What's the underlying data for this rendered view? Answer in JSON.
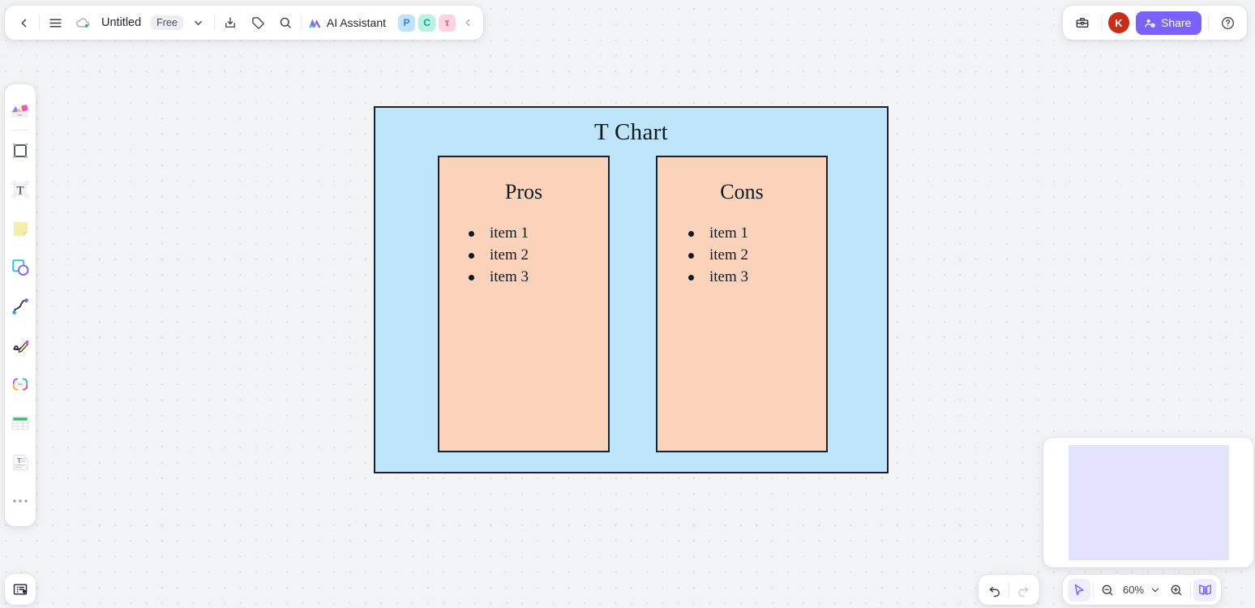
{
  "app": {
    "canvas_background": "#f2f3f5",
    "accent_color": "#7b61ff"
  },
  "topbar_left": {
    "back_icon": "chevron-left-icon",
    "menu_icon": "hamburger-menu-icon",
    "cloud_icon": "cloud-synced-icon",
    "doc_title": "Untitled",
    "plan_badge": "Free",
    "title_caret_icon": "chevron-down-icon",
    "import_export_icon": "download-icon",
    "tag_icon": "tag-icon",
    "search_icon": "search-icon",
    "ai_assistant_label": "AI Assistant",
    "ai_assistant_icon": "ai-sparkle-icon",
    "applets": [
      {
        "name": "presentation-applet",
        "letter": "P",
        "bg": "#bfe4fb",
        "fg": "#3c7fe0"
      },
      {
        "name": "mindmap-applet",
        "letter": "C",
        "bg": "#b9f2e3",
        "fg": "#12a98a"
      },
      {
        "name": "flowchart-applet",
        "letter": "τ",
        "bg": "#fcd3de",
        "fg": "#e8487d"
      }
    ],
    "collapse_icon": "chevron-left-icon"
  },
  "topbar_right": {
    "toolbox_icon": "toolbox-icon",
    "avatar_initial": "K",
    "avatar_color": "#cf2a14",
    "share_label": "Share",
    "share_icon": "user-add-icon",
    "help_icon": "help-circle-icon"
  },
  "tool_rail": {
    "items": [
      {
        "name": "tool-templates",
        "icon": "templates-icon"
      },
      {
        "name": "tool-frame",
        "icon": "frame-icon"
      },
      {
        "name": "tool-text",
        "icon": "text-T-icon"
      },
      {
        "name": "tool-sticky-note",
        "icon": "sticky-note-icon"
      },
      {
        "name": "tool-shapes",
        "icon": "shapes-icon"
      },
      {
        "name": "tool-connector",
        "icon": "curve-connector-icon"
      },
      {
        "name": "tool-pen",
        "icon": "pen-draw-icon"
      },
      {
        "name": "tool-mindmap",
        "icon": "mindmap-icon"
      },
      {
        "name": "tool-table",
        "icon": "table-icon"
      },
      {
        "name": "tool-document",
        "icon": "document-text-icon"
      },
      {
        "name": "tool-more",
        "icon": "more-dots-icon"
      }
    ]
  },
  "bottom_left": {
    "slides_icon": "presentation-slides-icon"
  },
  "bottom_right": {
    "undo_icon": "undo-arrow-icon",
    "redo_icon": "redo-arrow-icon",
    "redo_disabled": true,
    "select_icon": "cursor-select-icon",
    "zoom_out_icon": "zoom-out-icon",
    "zoom_level": "60%",
    "zoom_caret_icon": "chevron-down-icon",
    "zoom_in_icon": "zoom-in-icon",
    "minimap_toggle_icon": "minimap-book-icon"
  },
  "minimap": {
    "viewport_color": "#e4e3fd"
  },
  "artifact": {
    "type": "t-chart",
    "title": "T Chart",
    "frame_fill": "#bfe5fb",
    "frame_stroke": "#16212b",
    "column_fill": "#fbd3ba",
    "column_stroke": "#16212b",
    "columns": [
      {
        "heading": "Pros",
        "items": [
          "item 1",
          "item 2",
          "item 3"
        ]
      },
      {
        "heading": "Cons",
        "items": [
          "item 1",
          "item 2",
          "item 3"
        ]
      }
    ]
  }
}
